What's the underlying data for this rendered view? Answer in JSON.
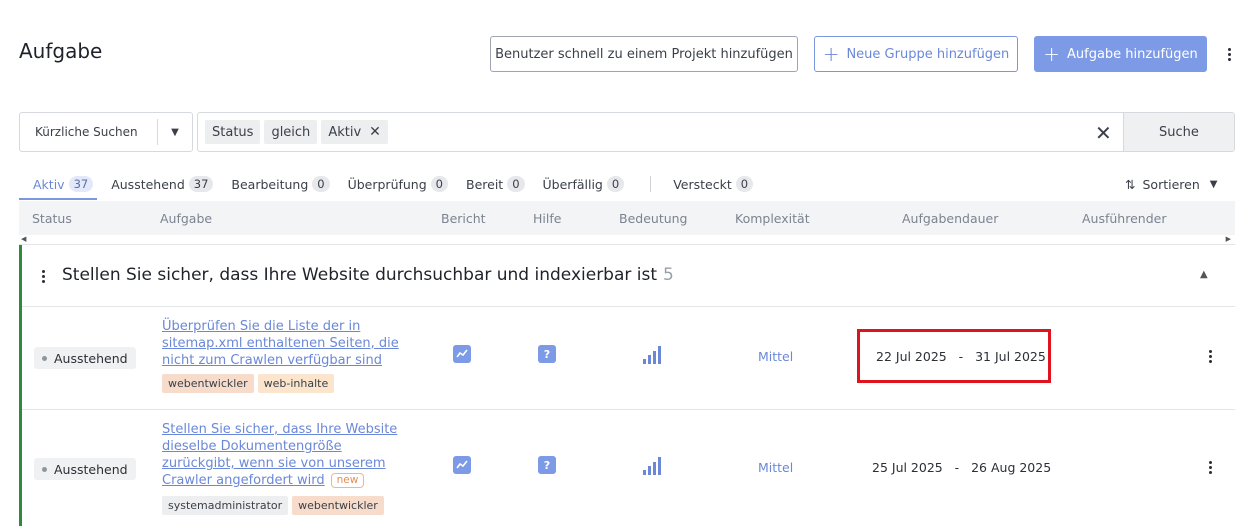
{
  "header": {
    "title": "Aufgabe",
    "btn_add_user": "Benutzer schnell zu einem Projekt hinzufügen",
    "btn_new_group": "Neue Gruppe hinzufügen",
    "btn_add_task": "Aufgabe hinzufügen"
  },
  "filter": {
    "recent_label": "Kürzliche Suchen",
    "chips": [
      "Status",
      "gleich",
      "Aktiv"
    ],
    "search_label": "Suche"
  },
  "tabs": [
    {
      "label": "Aktiv",
      "count": "37"
    },
    {
      "label": "Ausstehend",
      "count": "37"
    },
    {
      "label": "Bearbeitung",
      "count": "0"
    },
    {
      "label": "Überprüfung",
      "count": "0"
    },
    {
      "label": "Bereit",
      "count": "0"
    },
    {
      "label": "Überfällig",
      "count": "0"
    },
    {
      "label": "Versteckt",
      "count": "0"
    }
  ],
  "sort_label": "Sortieren",
  "columns": {
    "status": "Status",
    "task": "Aufgabe",
    "report": "Bericht",
    "help": "Hilfe",
    "importance": "Bedeutung",
    "complexity": "Komplexität",
    "duration": "Aufgabendauer",
    "executor": "Ausführender"
  },
  "group": {
    "title": "Stellen Sie sicher, dass Ihre Website durchsuchbar und indexierbar ist",
    "count": "5"
  },
  "rows": [
    {
      "status": "Ausstehend",
      "task": "Überprüfen Sie die Liste der in sitemap.xml enthaltenen Seiten, die nicht zum Crawlen verfügbar sind",
      "new": "",
      "tags": [
        "webentwickler",
        "web-inhalte"
      ],
      "help": "?",
      "complexity": "Mittel",
      "duration": "22 Jul 2025   -   31 Jul 2025"
    },
    {
      "status": "Ausstehend",
      "task": "Stellen Sie sicher, dass Ihre Website dieselbe Dokumentengröße zurückgibt, wenn sie von unserem Crawler angefordert wird",
      "new": "new",
      "tags": [
        "systemadministrator",
        "webentwickler"
      ],
      "help": "?",
      "complexity": "Mittel",
      "duration": "25 Jul 2025   -   26 Aug 2025"
    }
  ],
  "colors": {
    "accent": "#7d9ae6",
    "link": "#6b88d8",
    "group_border": "#2e8b3a",
    "highlight": "#e0141f"
  }
}
